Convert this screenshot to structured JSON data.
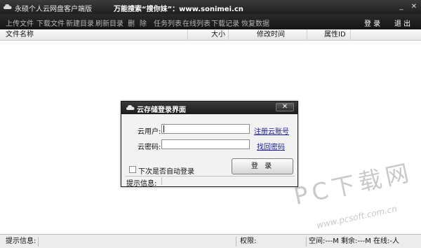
{
  "window": {
    "title": "永硕个人云网盘客户端版",
    "slogan": "万能搜索“搜你妹”：www.sonimei.cn",
    "minimize_icon": "minimize-icon",
    "close_icon": "close-icon",
    "min_glyph": "_",
    "close_glyph": "✕"
  },
  "toolbar": {
    "items": [
      "上传文件",
      "下载文件",
      "新建目录",
      "刷新目录",
      "删",
      "除",
      "任务列表",
      "在线列表",
      "下载记录",
      "恢复数据"
    ],
    "login": "登 录",
    "exit": "退 出"
  },
  "columns": [
    "文件名称",
    "大小",
    "修改时间",
    "属性ID"
  ],
  "status": {
    "hint_label": "提示信息:",
    "perm_label": "权限:",
    "space_text": "空间:---M 剩余:---M 在线:-人"
  },
  "watermark": {
    "text": "PC下载网",
    "url": "www.pcsoft.com.cn"
  },
  "dialog": {
    "title": "云存储登录界面",
    "close_glyph": "✕",
    "user_label": "云用户:",
    "user_value": "",
    "pass_label": "云密码:",
    "pass_value": "",
    "register_link": "注册云账号",
    "forgot_link": "找回密码",
    "auto_login": "下次是否自动登录",
    "login_button": "登 录",
    "status_label": "提示信息:"
  },
  "colors": {
    "titlebar": "#2b2b2b",
    "toolbar": "#1e1e1e",
    "link": "#1a1a9c"
  }
}
